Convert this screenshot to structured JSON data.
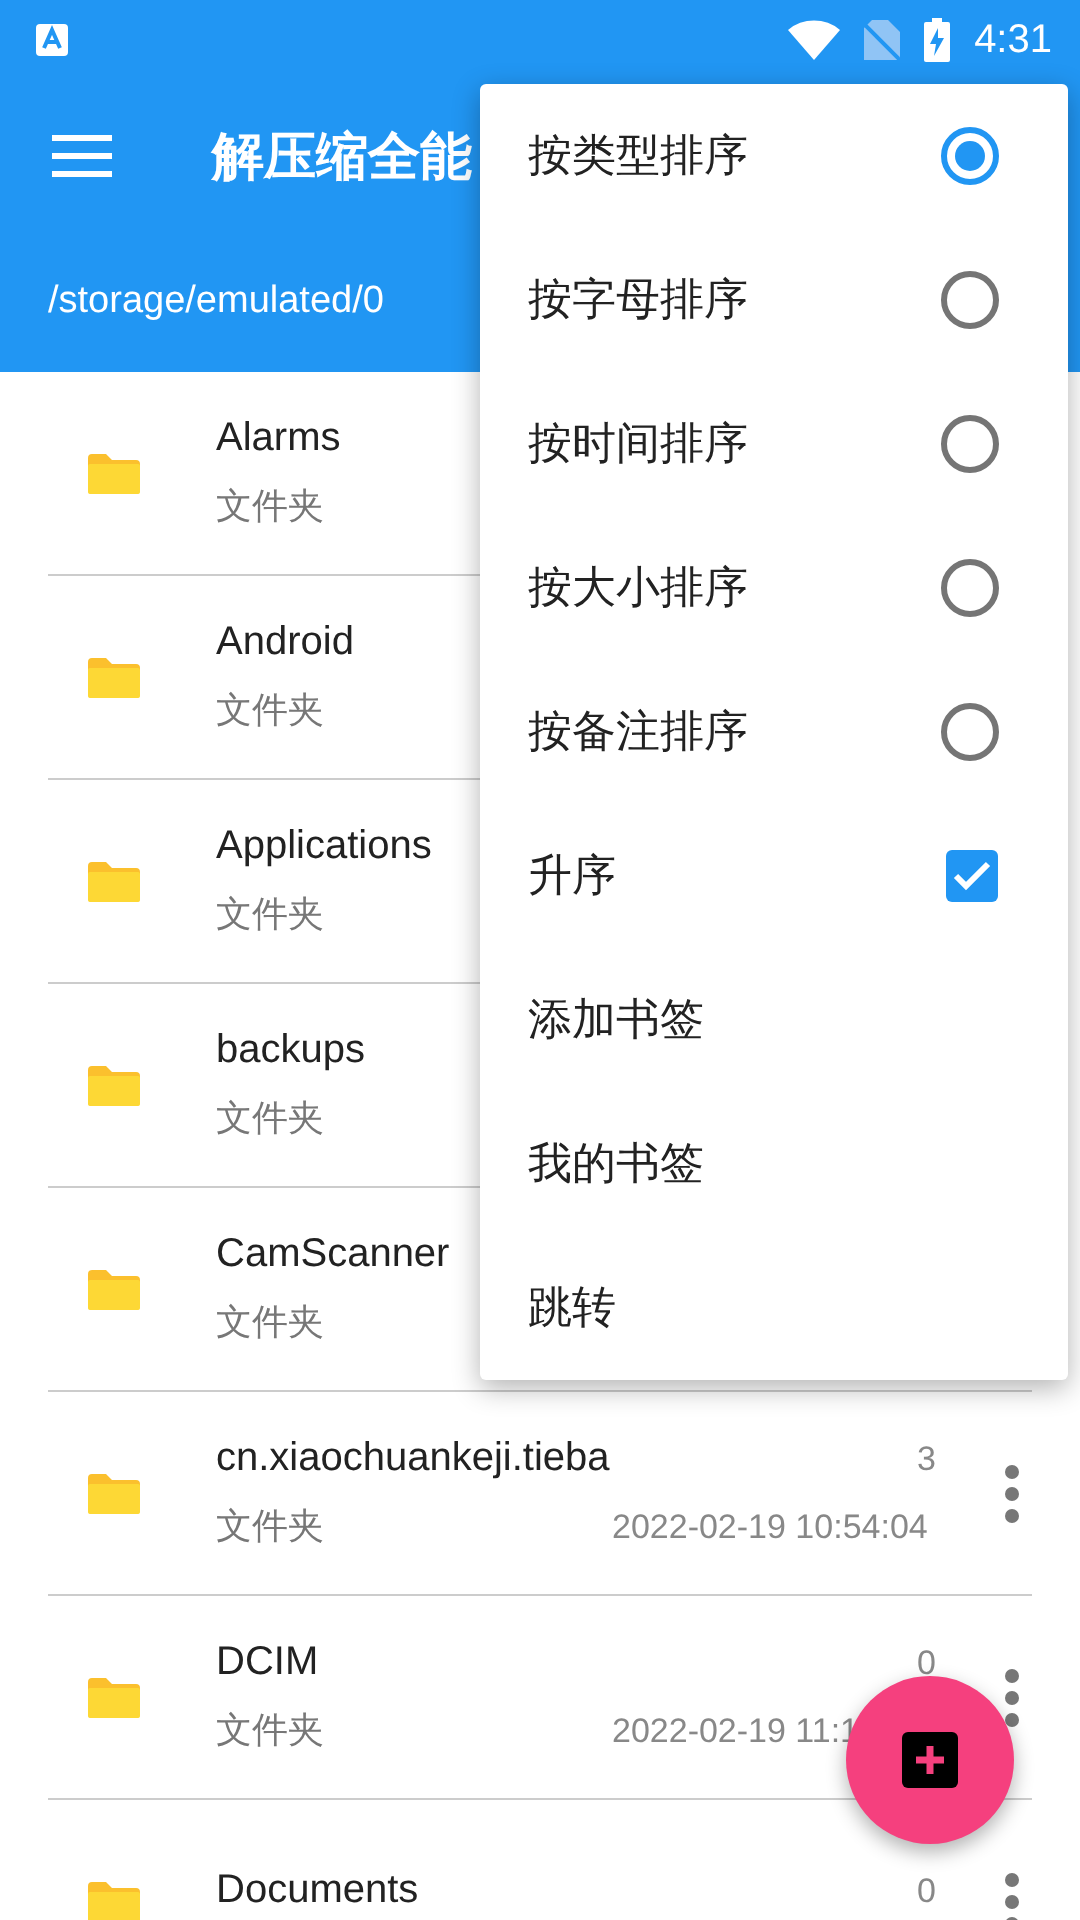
{
  "status_bar": {
    "time": "4:31"
  },
  "toolbar": {
    "title": "解压缩全能"
  },
  "path": "/storage/emulated/0",
  "rows": [
    {
      "name": "Alarms",
      "type": "文件夹"
    },
    {
      "name": "Android",
      "type": "文件夹"
    },
    {
      "name": "Applications",
      "type": "文件夹"
    },
    {
      "name": "backups",
      "type": "文件夹"
    },
    {
      "name": "CamScanner",
      "type": "文件夹"
    },
    {
      "name": "cn.xiaochuankeji.tieba",
      "type": "文件夹",
      "count": "3",
      "date": "2022-02-19 10:54:04"
    },
    {
      "name": "DCIM",
      "type": "文件夹",
      "count": "0",
      "date": "2022-02-19 11:1"
    },
    {
      "name": "Documents",
      "count": "0"
    }
  ],
  "menu": [
    {
      "kind": "radio",
      "label": "按类型排序",
      "selected": true
    },
    {
      "kind": "radio",
      "label": "按字母排序",
      "selected": false
    },
    {
      "kind": "radio",
      "label": "按时间排序",
      "selected": false
    },
    {
      "kind": "radio",
      "label": "按大小排序",
      "selected": false
    },
    {
      "kind": "radio",
      "label": "按备注排序",
      "selected": false
    },
    {
      "kind": "checkbox",
      "label": "升序",
      "checked": true
    },
    {
      "kind": "plain",
      "label": "添加书签"
    },
    {
      "kind": "plain",
      "label": "我的书签"
    },
    {
      "kind": "plain",
      "label": "跳转"
    }
  ]
}
